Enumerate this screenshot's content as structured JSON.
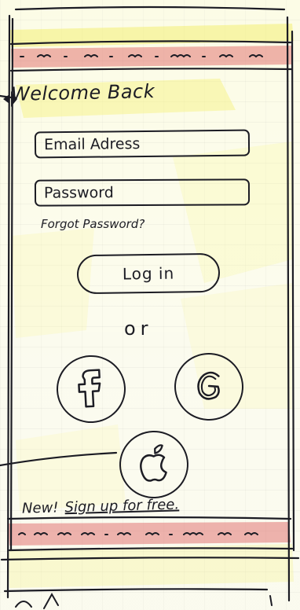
{
  "header": {
    "title": "Welcome Back"
  },
  "form": {
    "email_placeholder": "Email Adress",
    "password_placeholder": "Password",
    "forgot_label": "Forgot Password?",
    "login_label": "Log in",
    "or_label": "or"
  },
  "social": {
    "facebook_icon": "facebook-icon",
    "google_icon": "google-icon",
    "apple_icon": "apple-icon"
  },
  "signup": {
    "prompt": "New!",
    "link_label": "Sign up for free."
  },
  "colors": {
    "ink": "#1c1c24",
    "highlight_yellow": "#f4f07a",
    "highlight_red": "#e07070",
    "paper": "#fbfbf1"
  }
}
